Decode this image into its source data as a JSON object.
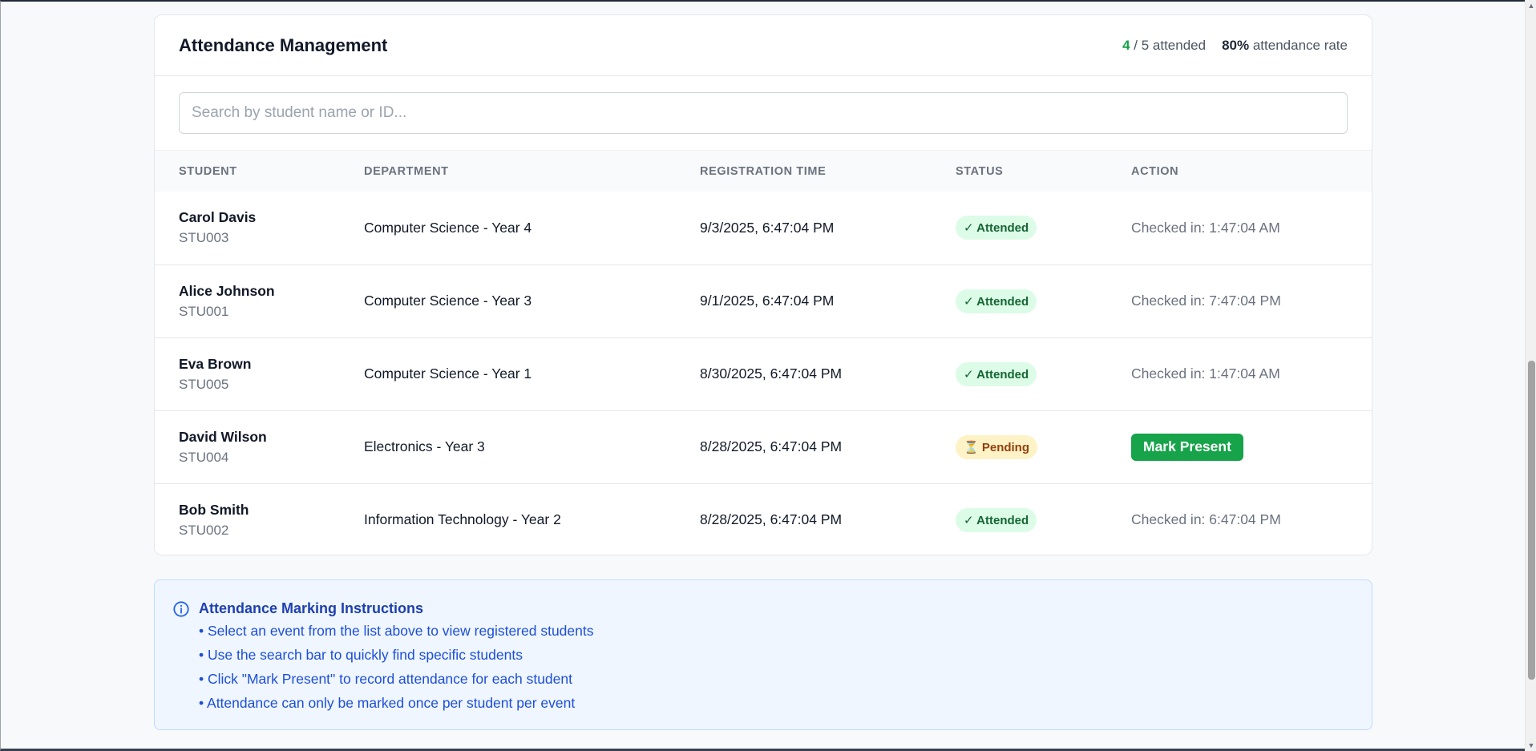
{
  "header": {
    "title": "Attendance Management",
    "attended_count": "4",
    "attended_rest": "/ 5 attended",
    "rate_value": "80%",
    "rate_rest": "attendance rate"
  },
  "search": {
    "placeholder": "Search by student name or ID...",
    "value": ""
  },
  "table": {
    "columns": [
      "STUDENT",
      "DEPARTMENT",
      "REGISTRATION TIME",
      "STATUS",
      "ACTION"
    ],
    "rows": [
      {
        "name": "Carol Davis",
        "id": "STU003",
        "department": "Computer Science - Year 4",
        "registered": "9/3/2025, 6:47:04 PM",
        "status": "✓ Attended",
        "action": "Checked in: 1:47:04 AM"
      },
      {
        "name": "Alice Johnson",
        "id": "STU001",
        "department": "Computer Science - Year 3",
        "registered": "9/1/2025, 6:47:04 PM",
        "status": "✓ Attended",
        "action": "Checked in: 7:47:04 PM"
      },
      {
        "name": "Eva Brown",
        "id": "STU005",
        "department": "Computer Science - Year 1",
        "registered": "8/30/2025, 6:47:04 PM",
        "status": "✓ Attended",
        "action": "Checked in: 1:47:04 AM"
      },
      {
        "name": "David Wilson",
        "id": "STU004",
        "department": "Electronics - Year 3",
        "registered": "8/28/2025, 6:47:04 PM",
        "status": "⏳ Pending",
        "action": "Mark Present"
      },
      {
        "name": "Bob Smith",
        "id": "STU002",
        "department": "Information Technology - Year 2",
        "registered": "8/28/2025, 6:47:04 PM",
        "status": "✓ Attended",
        "action": "Checked in: 6:47:04 PM"
      }
    ]
  },
  "instructions": {
    "icon": "info-circle-icon",
    "title": "Attendance Marking Instructions",
    "items": [
      "• Select an event from the list above to view registered students",
      "• Use the search bar to quickly find specific students",
      "• Click \"Mark Present\" to record attendance for each student",
      "• Attendance can only be marked once per student per event"
    ]
  },
  "colors": {
    "accent_green": "#16a34a",
    "attended_bg": "#dcfce7",
    "pending_bg": "#fef3c7",
    "info_bg": "#eff6ff",
    "info_text": "#1d4ed8"
  }
}
